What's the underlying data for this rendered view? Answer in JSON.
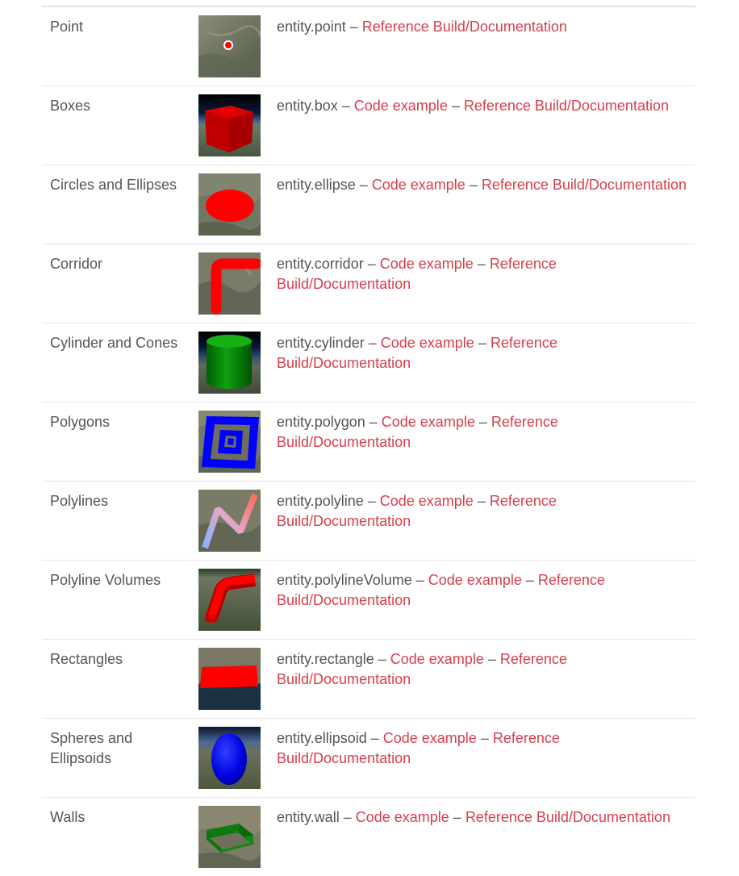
{
  "separator": " – ",
  "rows": [
    {
      "name": "Point",
      "api": "entity.point",
      "code": "",
      "ref": "Reference Build/Documentation",
      "icon": "point-thumbnail-icon"
    },
    {
      "name": "Boxes",
      "api": "entity.box",
      "code": "Code example",
      "ref": "Reference Build/Documentation",
      "icon": "box-thumbnail-icon"
    },
    {
      "name": "Circles and Ellipses",
      "api": "entity.ellipse",
      "code": "Code example",
      "ref": "Reference Build/Documentation",
      "icon": "ellipse-thumbnail-icon"
    },
    {
      "name": "Corridor",
      "api": "entity.corridor",
      "code": "Code example",
      "ref": "Reference Build/Documentation",
      "icon": "corridor-thumbnail-icon"
    },
    {
      "name": "Cylinder and Cones",
      "api": "entity.cylinder",
      "code": "Code example",
      "ref": "Reference Build/Documentation",
      "icon": "cylinder-thumbnail-icon"
    },
    {
      "name": "Polygons",
      "api": "entity.polygon",
      "code": "Code example",
      "ref": "Reference Build/Documentation",
      "icon": "polygon-thumbnail-icon"
    },
    {
      "name": "Polylines",
      "api": "entity.polyline",
      "code": "Code example",
      "ref": "Reference Build/Documentation",
      "icon": "polyline-thumbnail-icon"
    },
    {
      "name": "Polyline Volumes",
      "api": "entity.polylineVolume",
      "code": "Code example",
      "ref": "Reference Build/Documentation",
      "icon": "polyline-volume-thumbnail-icon"
    },
    {
      "name": "Rectangles",
      "api": "entity.rectangle",
      "code": "Code example",
      "ref": "Reference Build/Documentation",
      "icon": "rectangle-thumbnail-icon"
    },
    {
      "name": "Spheres and Ellipsoids",
      "api": "entity.ellipsoid",
      "code": "Code example",
      "ref": "Reference Build/Documentation",
      "icon": "ellipsoid-thumbnail-icon"
    },
    {
      "name": "Walls",
      "api": "entity.wall",
      "code": "Code example",
      "ref": "Reference Build/Documentation",
      "icon": "wall-thumbnail-icon"
    }
  ],
  "colors": {
    "text": "#555555",
    "link": "#d63e4c",
    "divider": "#e6e6e6"
  }
}
